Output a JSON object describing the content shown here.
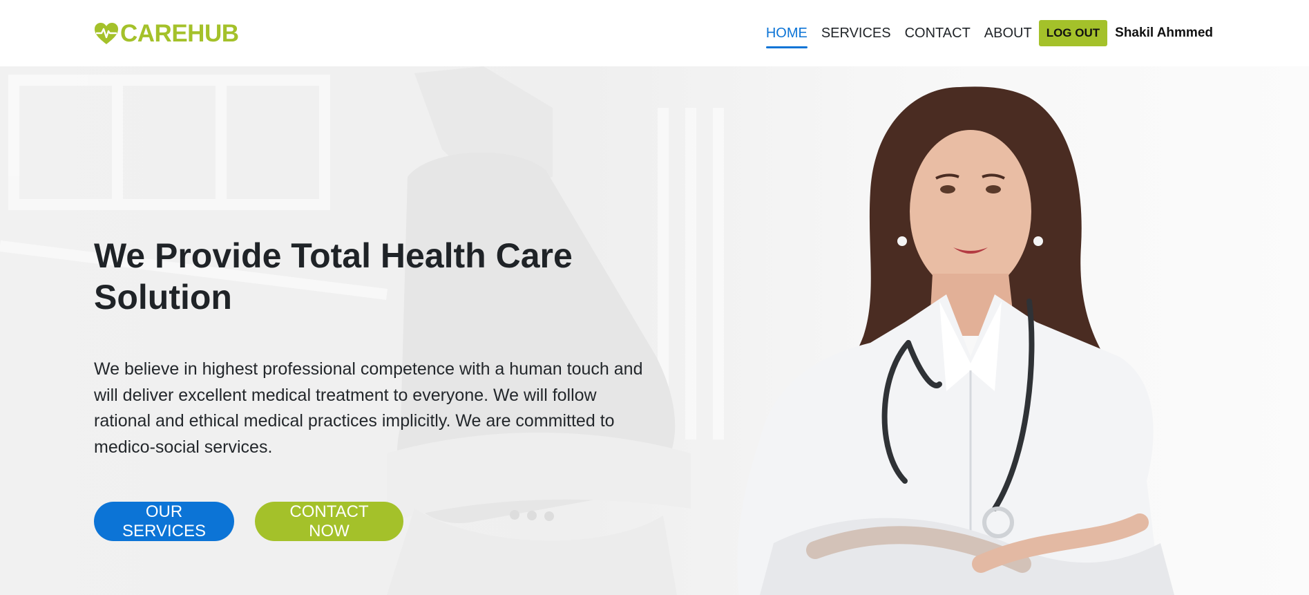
{
  "brand": {
    "name": "CAREHUB",
    "icon": "heart-pulse-icon",
    "color": "#a4c12a"
  },
  "nav": {
    "items": [
      {
        "label": "HOME",
        "active": true
      },
      {
        "label": "SERVICES",
        "active": false
      },
      {
        "label": "CONTACT",
        "active": false
      },
      {
        "label": "ABOUT",
        "active": false
      }
    ],
    "logout_label": "LOG OUT",
    "user_name": "Shakil Ahmmed",
    "active_color": "#0c74d6"
  },
  "hero": {
    "title": "We Provide Total Health Care Solution",
    "text": "We believe in highest professional competence with a human touch and will deliver excellent medical treatment to everyone. We will follow rational and ethical medical practices implicitly. We are committed to medico-social services.",
    "primary_button": "OUR SERVICES",
    "secondary_button": "CONTACT NOW",
    "primary_color": "#0c74d6",
    "secondary_color": "#a4c12a"
  }
}
